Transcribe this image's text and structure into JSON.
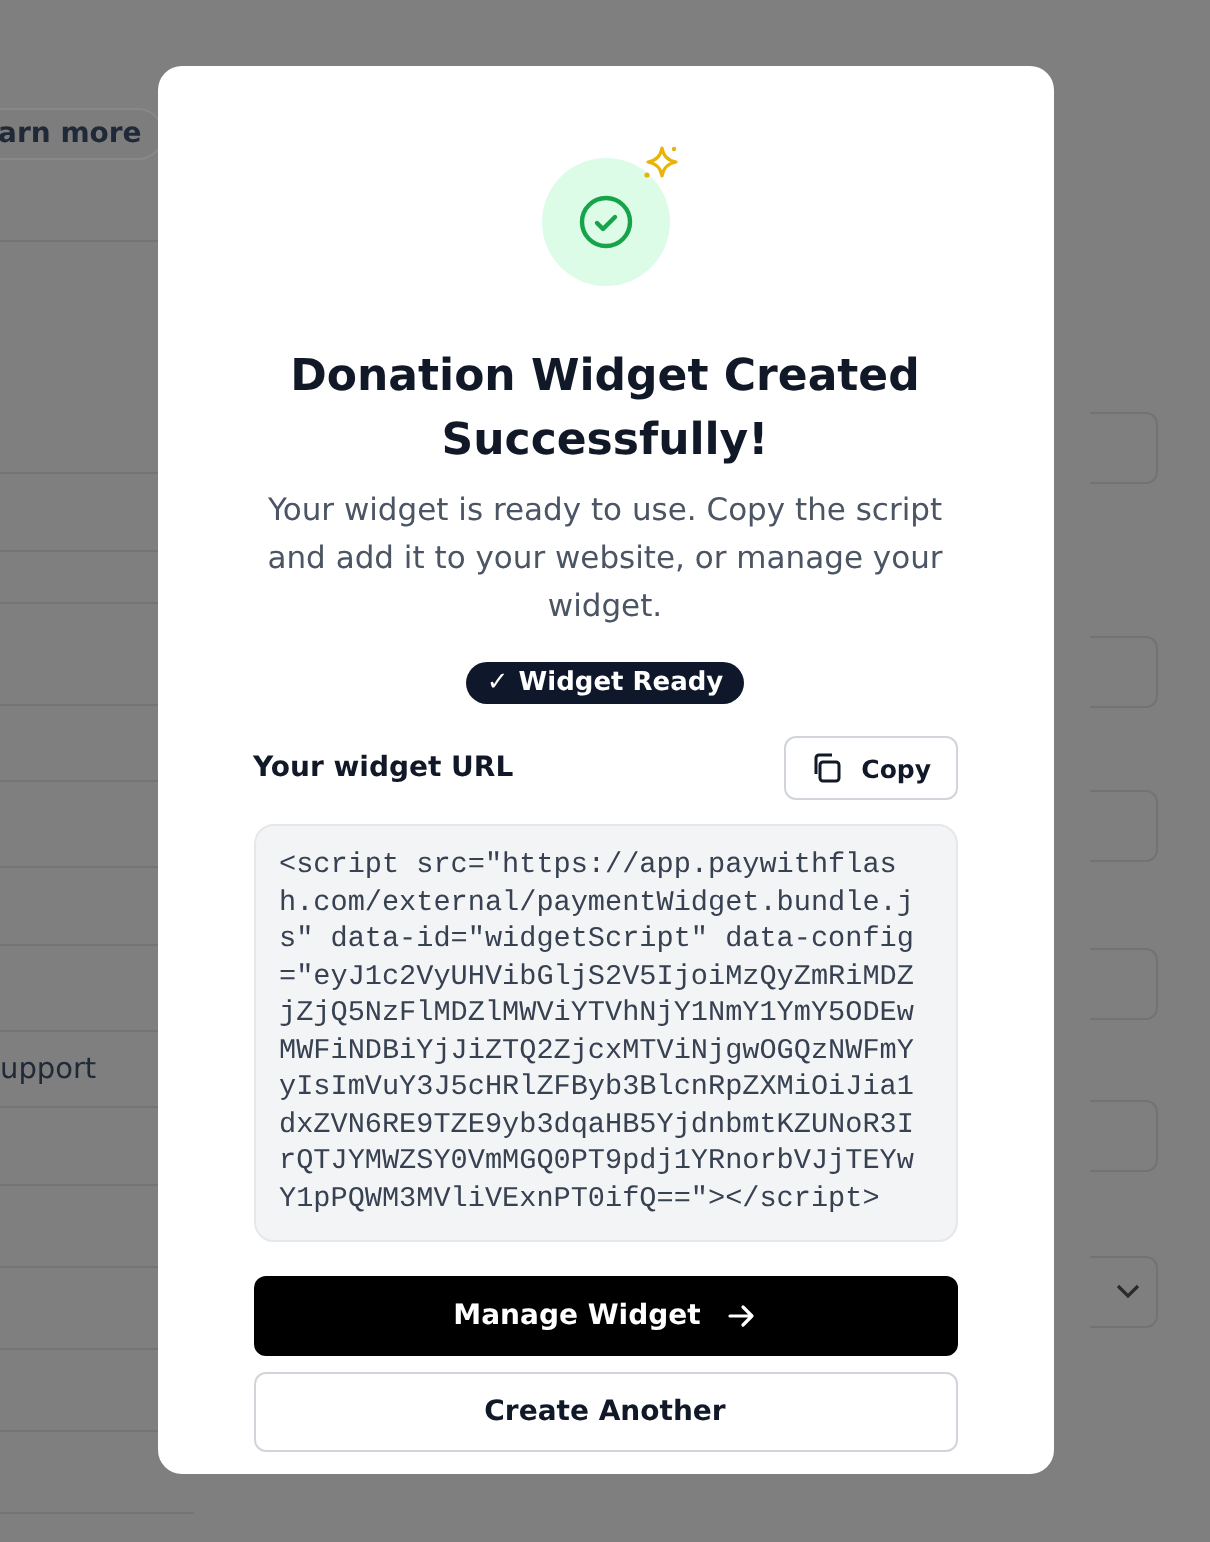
{
  "background_page": {
    "learn_more_button": "arn more",
    "support_label": "upport",
    "fields": [
      {
        "kind": "input"
      },
      {
        "kind": "input"
      },
      {
        "kind": "input"
      },
      {
        "kind": "input"
      },
      {
        "kind": "input"
      },
      {
        "kind": "select"
      }
    ]
  },
  "dialog": {
    "title": "Donation Widget Created Successfully!",
    "description": "Your widget is ready to use. Copy the script and add it to your website, or manage your widget.",
    "badge": {
      "icon": "✓",
      "label": "Widget Ready"
    },
    "url_label": "Your widget URL",
    "copy_button": "Copy",
    "script_code": "<script src=\"https://app.paywithflash.com/external/paymentWidget.bundle.js\" data-id=\"widgetScript\" data-config=\"eyJ1c2VyUHVibGljS2V5IjoiMzQyZmRiMDZjZjQ5NzFlMDZlMWViYTVhNjY1NmY1YmY5ODEwMWFiNDBiYjJiZTQ2ZjcxMTViNjgwOGQzNWFmYyIsImVuY3J5cHRlZFByb3BlcnRpZXMiOiJia1dxZVN6RE9TZE9yb3dqaHB5YjdnbmtKZUNoR3IrQTJYMWZSY0VmMGQ0PT9pdj1YRnorbVJjTEYwY1pPQWM3MVliVExnPT0ifQ==\"></script>",
    "primary_button": "Manage Widget",
    "secondary_button": "Create Another"
  }
}
